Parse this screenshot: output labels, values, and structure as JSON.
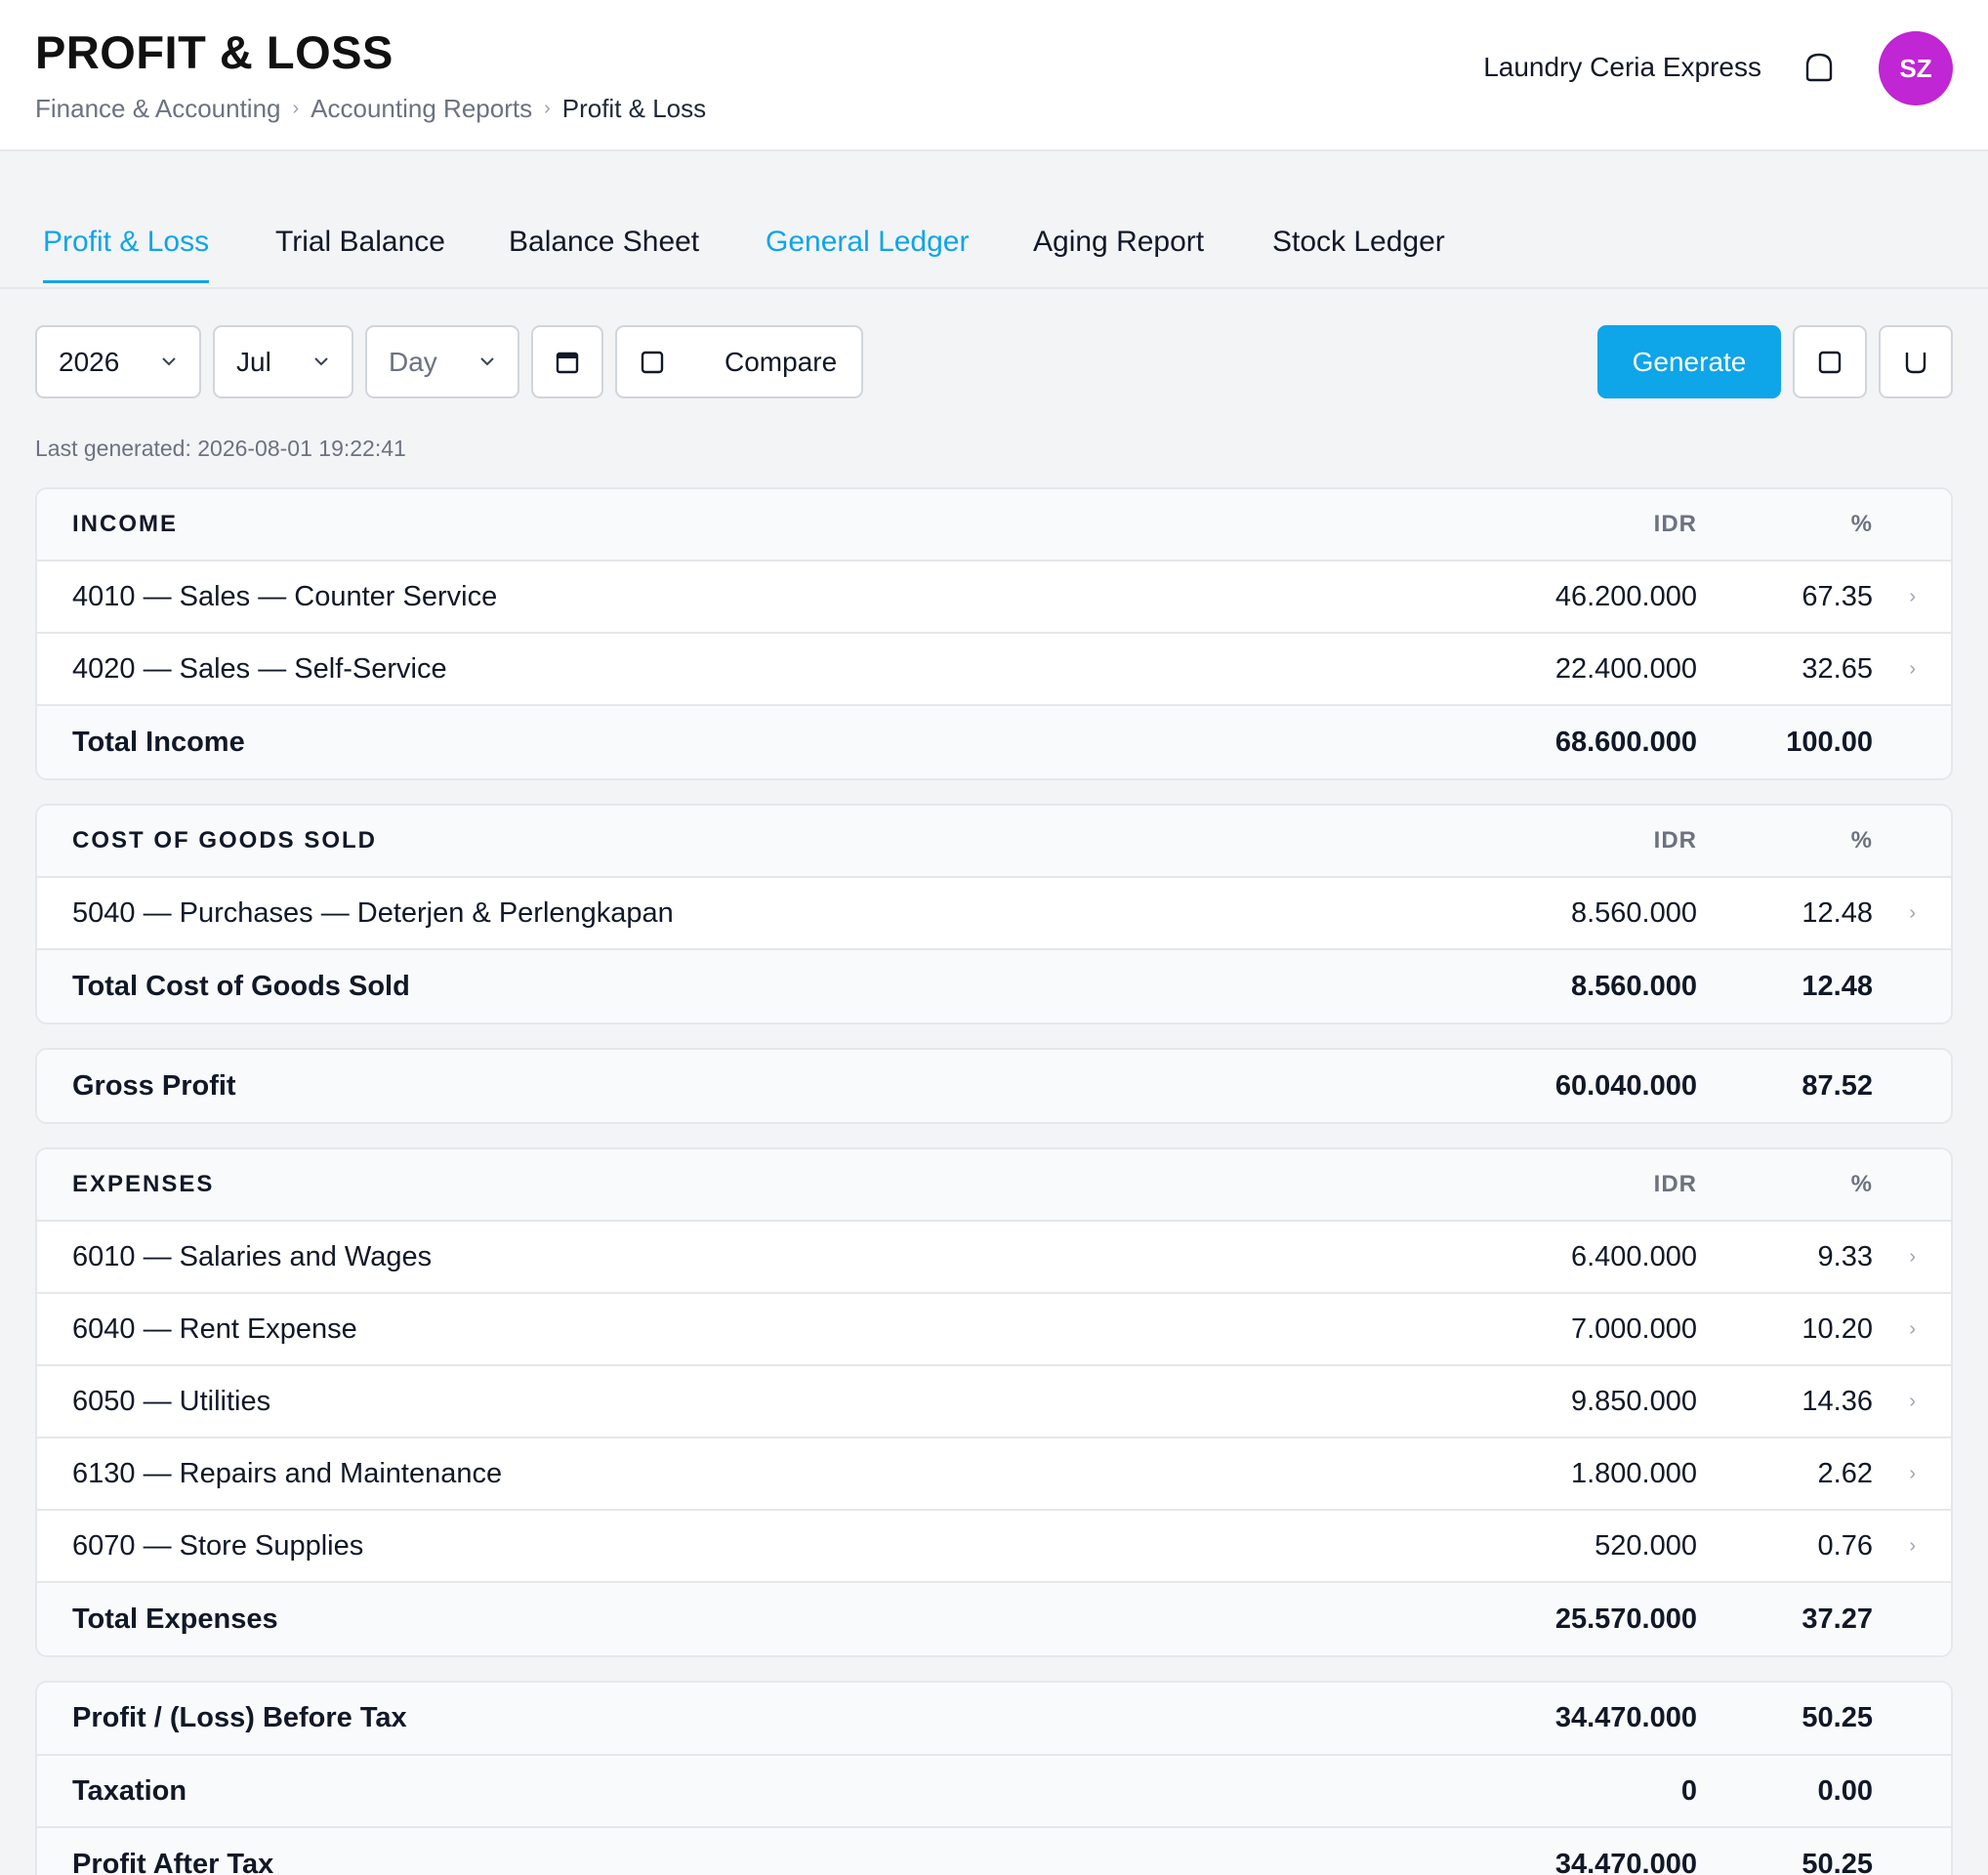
{
  "header": {
    "title": "PROFIT & LOSS",
    "breadcrumb": [
      "Finance & Accounting",
      "Accounting Reports",
      "Profit & Loss"
    ],
    "org_name": "Laundry Ceria Express",
    "avatar_initials": "SZ",
    "avatar_color": "#c026d3"
  },
  "tabs": [
    {
      "label": "Profit & Loss",
      "state": "active"
    },
    {
      "label": "Trial Balance"
    },
    {
      "label": "Balance Sheet"
    },
    {
      "label": "General Ledger",
      "state": "link"
    },
    {
      "label": "Aging Report"
    },
    {
      "label": "Stock Ledger"
    }
  ],
  "toolbar": {
    "year": "2026",
    "month": "Jul",
    "day_placeholder": "Day",
    "compare_label": "Compare",
    "generate_label": "Generate",
    "last_generated": "Last generated: 2026-08-01 19:22:41",
    "accent": "#0ea5e9"
  },
  "income": {
    "title": "INCOME",
    "col_amount": "IDR",
    "col_pct": "%",
    "rows": [
      {
        "label": "4010 — Sales — Counter Service",
        "amount": "46.200.000",
        "pct": "67.35"
      },
      {
        "label": "4020 — Sales — Self-Service",
        "amount": "22.400.000",
        "pct": "32.65"
      }
    ],
    "total": {
      "label": "Total Income",
      "amount": "68.600.000",
      "pct": "100.00"
    }
  },
  "cogs": {
    "title": "COST OF GOODS SOLD",
    "col_amount": "IDR",
    "col_pct": "%",
    "rows": [
      {
        "label": "5040 — Purchases — Deterjen & Perlengkapan",
        "amount": "8.560.000",
        "pct": "12.48"
      }
    ],
    "total": {
      "label": "Total Cost of Goods Sold",
      "amount": "8.560.000",
      "pct": "12.48"
    }
  },
  "gross_profit": {
    "label": "Gross Profit",
    "amount": "60.040.000",
    "pct": "87.52"
  },
  "expenses": {
    "title": "EXPENSES",
    "col_amount": "IDR",
    "col_pct": "%",
    "rows": [
      {
        "label": "6010 — Salaries and Wages",
        "amount": "6.400.000",
        "pct": "9.33"
      },
      {
        "label": "6040 — Rent Expense",
        "amount": "7.000.000",
        "pct": "10.20"
      },
      {
        "label": "6050 — Utilities",
        "amount": "9.850.000",
        "pct": "14.36"
      },
      {
        "label": "6130 — Repairs and Maintenance",
        "amount": "1.800.000",
        "pct": "2.62"
      },
      {
        "label": "6070 — Store Supplies",
        "amount": "520.000",
        "pct": "0.76"
      }
    ],
    "total": {
      "label": "Total Expenses",
      "amount": "25.570.000",
      "pct": "37.27"
    }
  },
  "summary": [
    {
      "label": "Profit / (Loss) Before Tax",
      "amount": "34.470.000",
      "pct": "50.25"
    },
    {
      "label": "Taxation",
      "amount": "0",
      "pct": "0.00"
    },
    {
      "label": "Profit After Tax",
      "amount": "34.470.000",
      "pct": "50.25"
    }
  ]
}
